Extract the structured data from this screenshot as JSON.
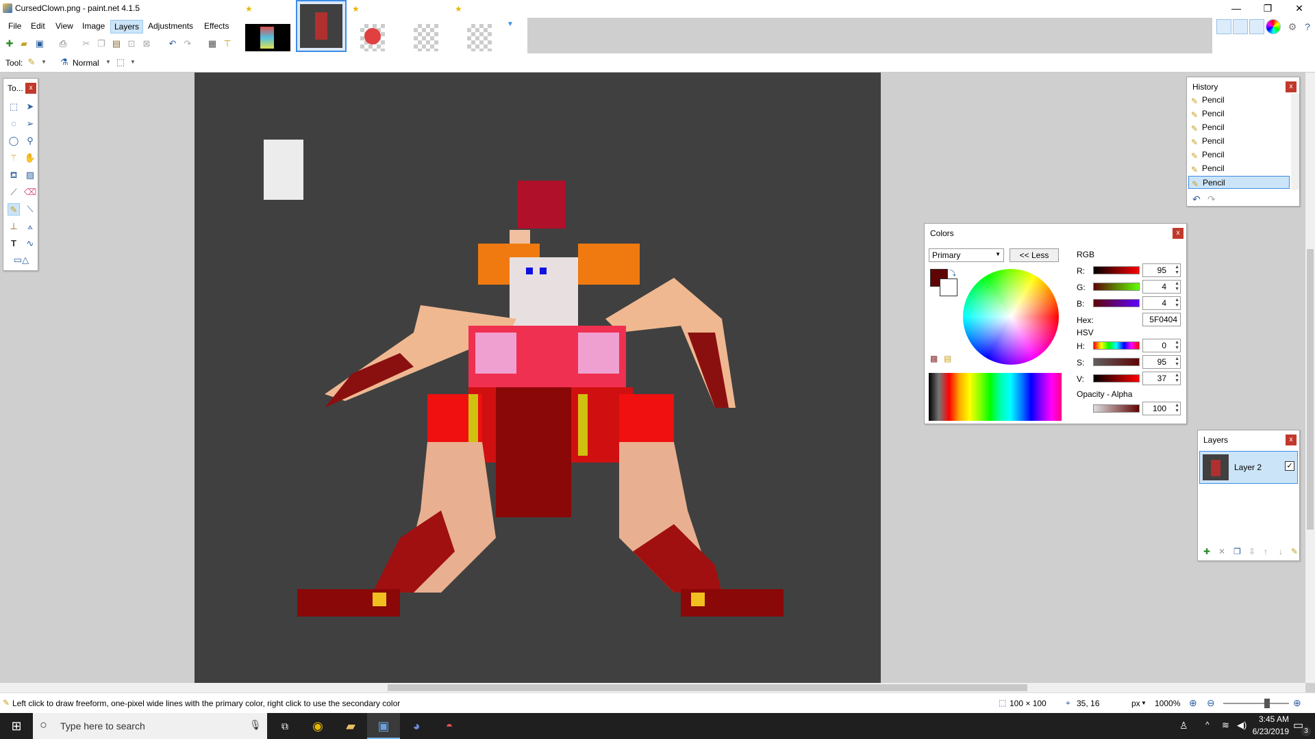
{
  "window": {
    "title": "CursedClown.png - paint.net 4.1.5"
  },
  "menu": [
    "File",
    "Edit",
    "View",
    "Image",
    "Layers",
    "Adjustments",
    "Effects"
  ],
  "toolbar": {
    "tool_label": "Tool:",
    "blend_mode": "Normal"
  },
  "tools_panel": {
    "title": "To..."
  },
  "history": {
    "title": "History",
    "items": [
      "Pencil",
      "Pencil",
      "Pencil",
      "Pencil",
      "Pencil",
      "Pencil",
      "Pencil"
    ]
  },
  "colors": {
    "title": "Colors",
    "mode_select": "Primary",
    "less_button": "<< Less",
    "rgb_label": "RGB",
    "r_label": "R:",
    "r": "95",
    "g_label": "G:",
    "g": "4",
    "b_label": "B:",
    "b": "4",
    "hex_label": "Hex:",
    "hex": "5F0404",
    "hsv_label": "HSV",
    "h_label": "H:",
    "h": "0",
    "s_label": "S:",
    "s": "95",
    "v_label": "V:",
    "v": "37",
    "opacity_label": "Opacity - Alpha",
    "alpha": "100",
    "primary_color": "#5F0404"
  },
  "layers": {
    "title": "Layers",
    "items": [
      {
        "name": "Layer 2",
        "visible": true
      }
    ]
  },
  "status": {
    "hint": "Left click to draw freeform, one-pixel wide lines with the primary color, right click to use the secondary color",
    "image_size": "100 × 100",
    "cursor_pos": "35, 16",
    "units": "px",
    "zoom": "1000%"
  },
  "taskbar": {
    "search_placeholder": "Type here to search",
    "time": "3:45 AM",
    "date": "6/23/2019",
    "notifications": "3"
  }
}
